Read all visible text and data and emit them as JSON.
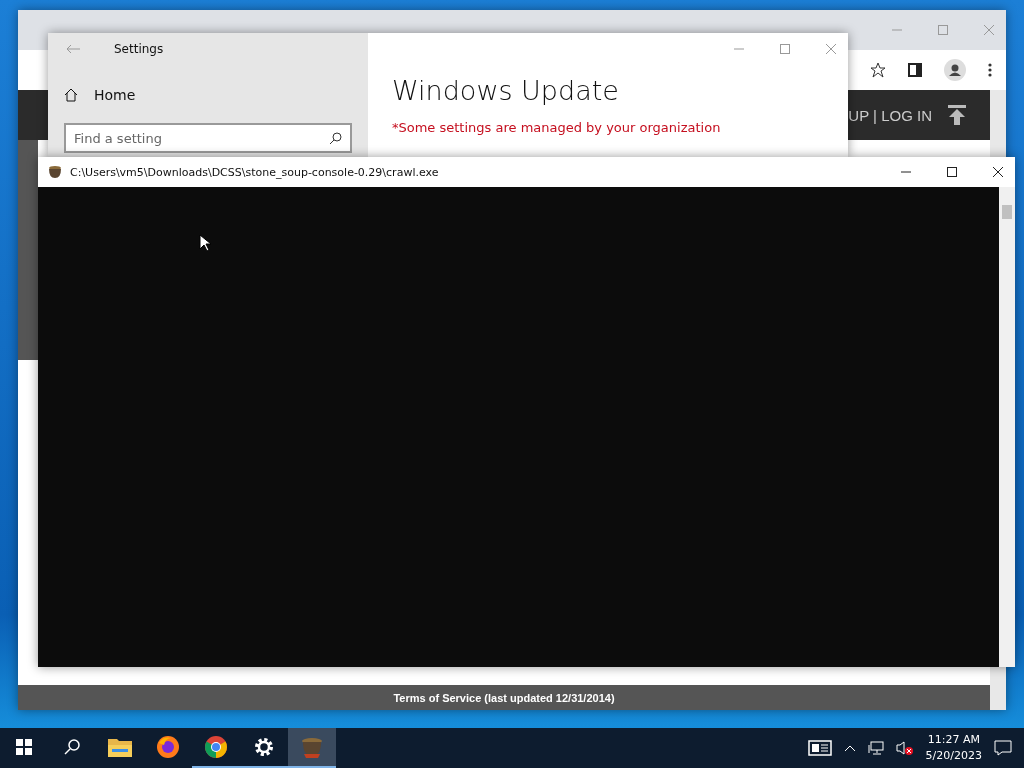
{
  "browser": {
    "header_link": "UP | LOG IN",
    "footer_text": "Terms of Service (last updated 12/31/2014)"
  },
  "settings": {
    "title": "Settings",
    "nav_home": "Home",
    "search_placeholder": "Find a setting",
    "heading": "Windows Update",
    "notice": "*Some settings are managed by your organization"
  },
  "console": {
    "title": "C:\\Users\\vm5\\Downloads\\DCSS\\stone_soup-console-0.29\\crawl.exe"
  },
  "taskbar": {
    "apps": [
      {
        "kind": "folder",
        "running": false,
        "selected": false
      },
      {
        "kind": "firefox",
        "running": false,
        "selected": false
      },
      {
        "kind": "chrome",
        "running": true,
        "selected": false
      },
      {
        "kind": "settings",
        "running": true,
        "selected": false
      },
      {
        "kind": "crawl",
        "running": true,
        "selected": true
      }
    ],
    "time": "11:27 AM",
    "date": "5/20/2023"
  }
}
